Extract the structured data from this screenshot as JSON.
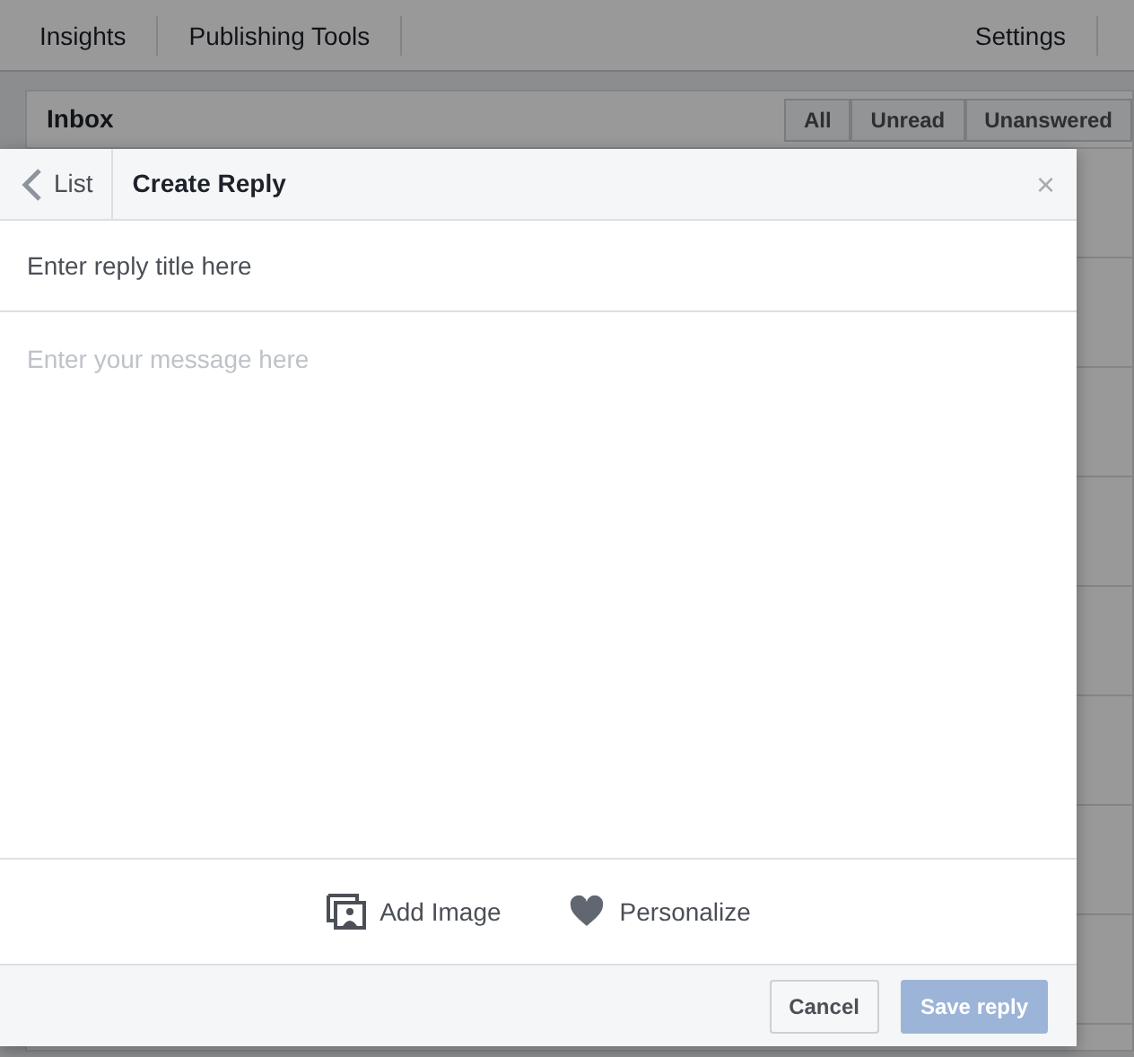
{
  "top_nav": {
    "left_items": [
      "Insights",
      "Publishing Tools"
    ],
    "right_items": [
      "Settings"
    ]
  },
  "inbox": {
    "title": "Inbox",
    "filters": [
      {
        "label": "All",
        "selected": false
      },
      {
        "label": "Unread",
        "selected": false
      },
      {
        "label": "Unanswered",
        "selected": false
      }
    ]
  },
  "dialog": {
    "back_label": "List",
    "title": "Create Reply",
    "close": "×",
    "title_field": {
      "placeholder": "Enter reply title here"
    },
    "message_field": {
      "placeholder": "Enter your message here"
    },
    "tools": [
      {
        "kind": "image",
        "label": "Add Image"
      },
      {
        "kind": "heart",
        "label": "Personalize"
      }
    ],
    "buttons": [
      {
        "label": "Cancel",
        "disabled": false,
        "primary": false
      },
      {
        "label": "Save reply",
        "disabled": true,
        "primary": true
      }
    ]
  }
}
